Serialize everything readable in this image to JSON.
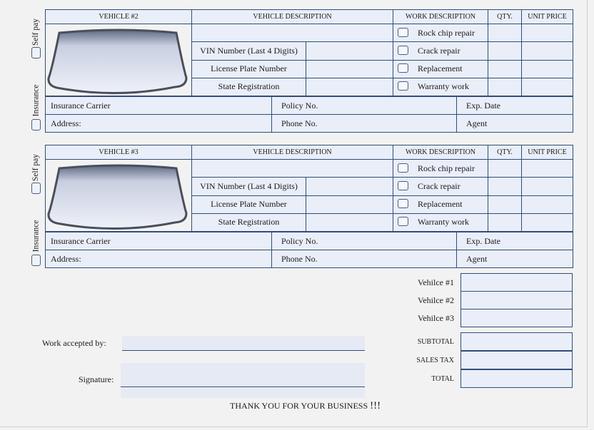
{
  "vehicles": [
    {
      "header": "VEHICLE #2",
      "self_pay_label": "Self pay",
      "insurance_label": "Insurance",
      "columns": {
        "vehicle_description": "VEHICLE DESCRIPTION",
        "work_description": "WORK DESCRIPTION",
        "qty": "QTY.",
        "unit_price": "UNIT PRICE"
      },
      "fields": {
        "vin": "VIN Number (Last 4 Digits)",
        "plate": "License Plate Number",
        "state": "State Registration"
      },
      "work_items": [
        "Rock chip repair",
        "Crack repair",
        "Replacement",
        "Warranty work"
      ],
      "insurance": {
        "carrier": "Insurance Carrier",
        "policy": "Policy No.",
        "exp_date": "Exp. Date",
        "address": "Address:",
        "phone": "Phone No.",
        "agent": "Agent"
      }
    },
    {
      "header": "VEHICLE #3",
      "self_pay_label": "Self pay",
      "insurance_label": "Insurance",
      "columns": {
        "vehicle_description": "VEHICLE DESCRIPTION",
        "work_description": "WORK DESCRIPTION",
        "qty": "QTY.",
        "unit_price": "UNIT PRICE"
      },
      "fields": {
        "vin": "VIN Number (Last 4 Digits)",
        "plate": "License Plate Number",
        "state": "State Registration"
      },
      "work_items": [
        "Rock chip repair",
        "Crack repair",
        "Replacement",
        "Warranty work"
      ],
      "insurance": {
        "carrier": "Insurance Carrier",
        "policy": "Policy No.",
        "exp_date": "Exp. Date",
        "address": "Address:",
        "phone": "Phone No.",
        "agent": "Agent"
      }
    }
  ],
  "totals": {
    "vehicle1": "Vehilce #1",
    "vehicle2": "Vehilce #2",
    "vehicle3": "Vehilce #3",
    "subtotal": "SUBTOTAL",
    "sales_tax": "SALES TAX",
    "total": "TOTAL"
  },
  "footer": {
    "work_accepted": "Work accepted by:",
    "signature": "Signature:",
    "thanks": "THANK YOU FOR YOUR BUSINESS",
    "thanks_bang": "!!!"
  },
  "colors": {
    "border": "#2f4e78",
    "field_fill": "#e9eef8",
    "page_bg": "#f2f2f2"
  },
  "icons": {
    "windshield": "windshield-icon",
    "checkbox": "checkbox-icon"
  }
}
